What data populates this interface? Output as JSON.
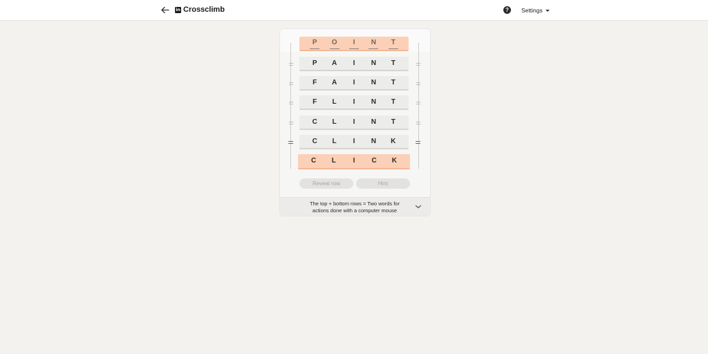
{
  "header": {
    "back_icon": "arrow-left-icon",
    "logo_text": "in",
    "title": "Crossclimb",
    "help_icon": "question-circle-icon",
    "help_glyph": "?",
    "settings_label": "Settings"
  },
  "puzzle": {
    "rows": [
      {
        "word": "POINT",
        "letters": [
          "P",
          "O",
          "I",
          "N",
          "T"
        ],
        "state": "locked-top"
      },
      {
        "word": "PAINT",
        "letters": [
          "P",
          "A",
          "I",
          "N",
          "T"
        ],
        "state": "normal"
      },
      {
        "word": "FAINT",
        "letters": [
          "F",
          "A",
          "I",
          "N",
          "T"
        ],
        "state": "normal"
      },
      {
        "word": "FLINT",
        "letters": [
          "F",
          "L",
          "I",
          "N",
          "T"
        ],
        "state": "normal"
      },
      {
        "word": "CLINT",
        "letters": [
          "C",
          "L",
          "I",
          "N",
          "T"
        ],
        "state": "normal"
      },
      {
        "word": "CLINK",
        "letters": [
          "C",
          "L",
          "I",
          "N",
          "K"
        ],
        "state": "normal"
      },
      {
        "word": "CLICK",
        "letters": [
          "C",
          "L",
          "I",
          "C",
          "K"
        ],
        "state": "locked-bottom"
      }
    ]
  },
  "buttons": {
    "reveal_label": "Reveal row",
    "hint_label": "Hint"
  },
  "clue": {
    "line1": "The top + bottom rows = Two words for",
    "line2": "actions done with a computer mouse",
    "chevron_icon": "chevron-down-icon"
  },
  "colors": {
    "locked_row": "#fcd0b6",
    "row": "#ececeb",
    "background": "#f3f2ef"
  }
}
